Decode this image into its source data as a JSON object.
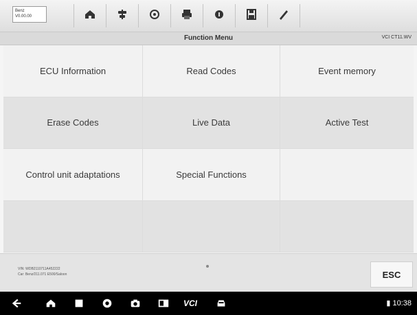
{
  "vehicle_info": {
    "make": "Benz",
    "version": "V0.00.00"
  },
  "toolbar": {
    "buttons": [
      {
        "name": "home-button",
        "icon": "home-icon"
      },
      {
        "name": "vehicle-swap-button",
        "icon": "vehicle-swap-icon"
      },
      {
        "name": "settings-button",
        "icon": "gear-icon"
      },
      {
        "name": "print-button",
        "icon": "printer-icon"
      },
      {
        "name": "help-button",
        "icon": "help-icon"
      },
      {
        "name": "save-button",
        "icon": "save-icon"
      },
      {
        "name": "data-logging-button",
        "icon": "pen-icon"
      }
    ]
  },
  "header": {
    "title": "Function Menu",
    "vci_status": "VCI CT11.WV"
  },
  "menu": {
    "items": [
      "ECU Information",
      "Read Codes",
      "Event memory",
      "Erase Codes",
      "Live Data",
      "Active Test",
      "Control unit adaptations",
      "Special Functions",
      "",
      "",
      "",
      ""
    ]
  },
  "footer": {
    "vin_line": "VIN: WDB2110711A452222",
    "car_line": "Car: Benz/211.071 E500/Saloon",
    "esc_label": "ESC"
  },
  "android_nav": {
    "vci_label": "VCI",
    "time": "10:38"
  }
}
